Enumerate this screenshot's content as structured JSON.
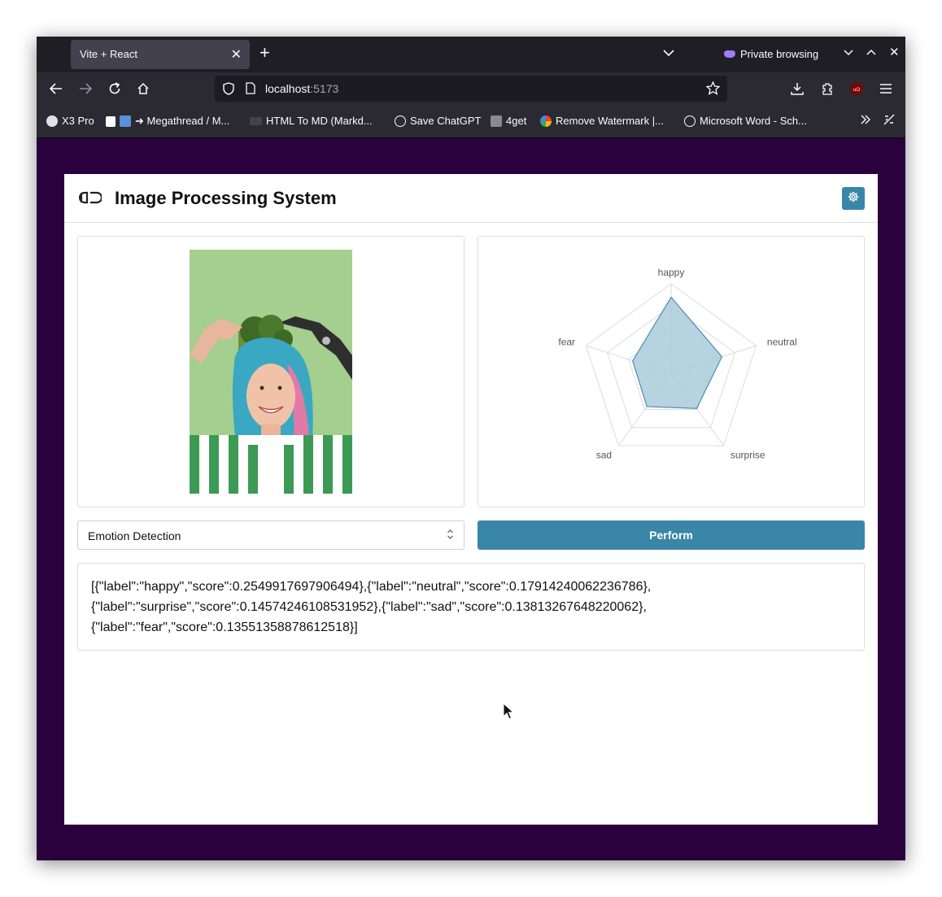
{
  "browser": {
    "tab_title": "Vite + React",
    "private_label": "Private browsing",
    "url_host": "localhost",
    "url_port": ":5173",
    "bookmarks": [
      "X3 Pro",
      "➜ Megathread / M...",
      "HTML To MD (Markd...",
      "Save ChatGPT",
      "4get",
      "Remove Watermark |...",
      "Microsoft Word - Sch..."
    ]
  },
  "app": {
    "title": "Image Processing System",
    "task_selected": "Emotion Detection",
    "perform_label": "Perform",
    "result_text": "[{\"label\":\"happy\",\"score\":0.2549917697906494},{\"label\":\"neutral\",\"score\":0.17914240062236786},{\"label\":\"surprise\",\"score\":0.14574246108531952},{\"label\":\"sad\",\"score\":0.13813267648220062},{\"label\":\"fear\",\"score\":0.13551358878612518}]",
    "accent_color": "#3a86a8",
    "background_color": "#2a003d"
  },
  "chart_data": {
    "type": "radar",
    "categories": [
      "happy",
      "neutral",
      "surprise",
      "sad",
      "fear"
    ],
    "values": [
      0.2549917697906494,
      0.17914240062236786,
      0.14574246108531952,
      0.13813267648220062,
      0.13551358878612518
    ],
    "rmax": 0.3,
    "grid_levels": 4,
    "fill_color": "#a9cbd9",
    "stroke_color": "#4a8fb3"
  }
}
